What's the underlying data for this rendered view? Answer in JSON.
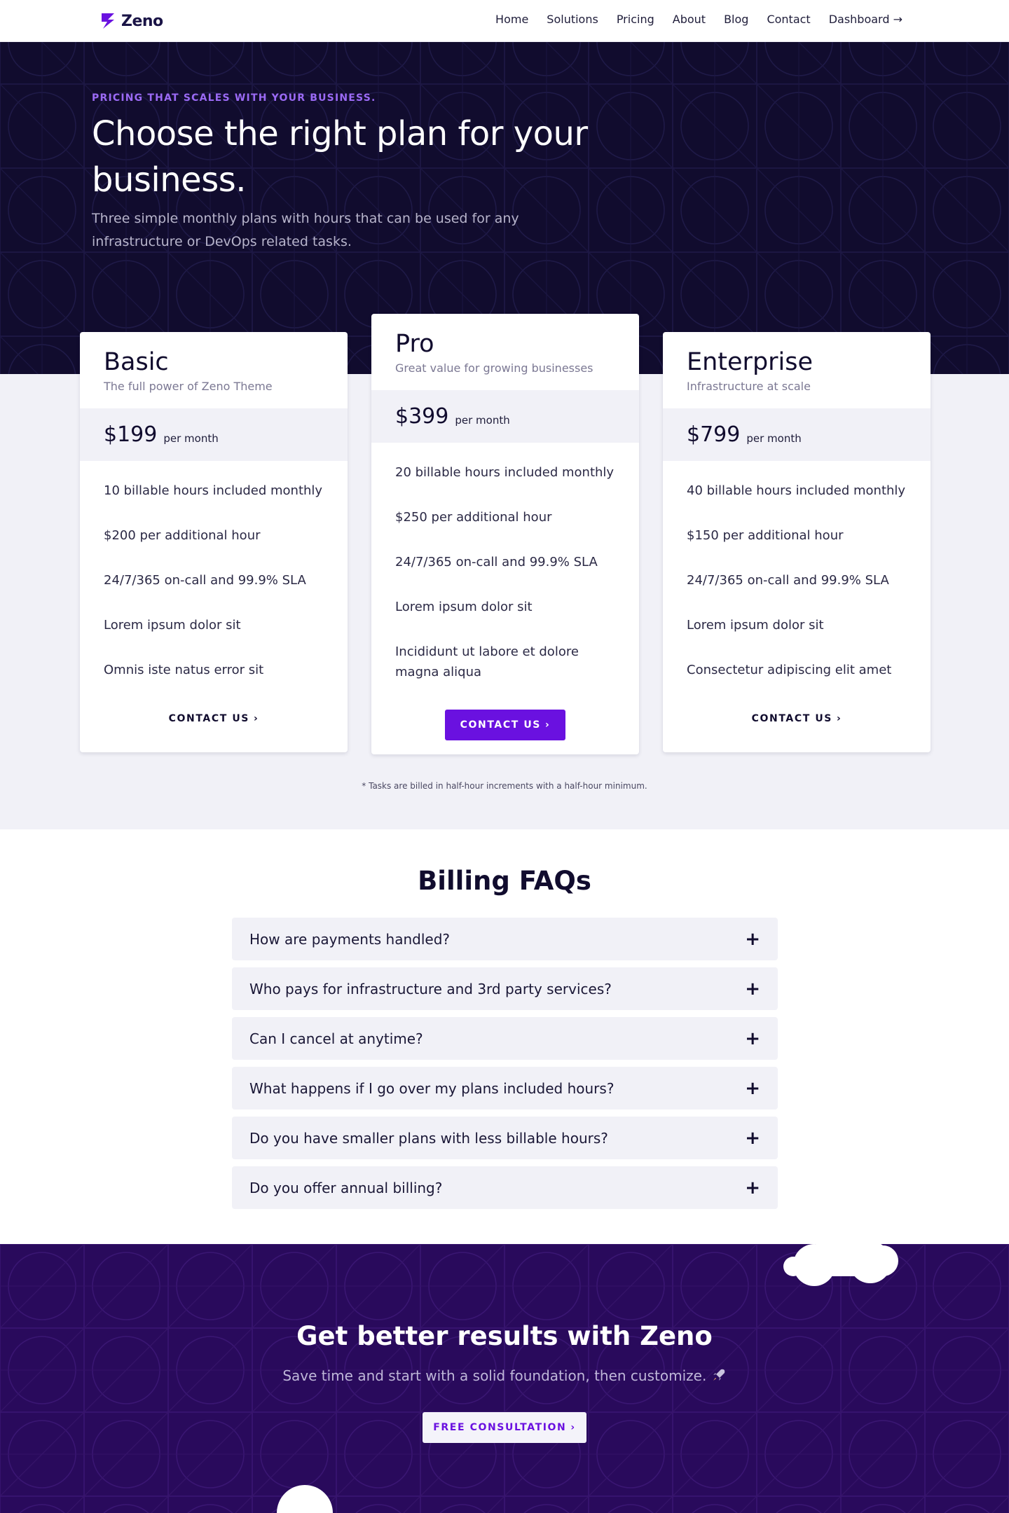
{
  "brand": {
    "name": "Zeno",
    "accent": "#6a11e0",
    "dark": "#110c2e"
  },
  "nav": {
    "links": [
      "Home",
      "Solutions",
      "Pricing",
      "About",
      "Blog",
      "Contact",
      "Dashboard"
    ],
    "dashboard_arrow": "→"
  },
  "hero": {
    "eyebrow": "PRICING THAT SCALES WITH YOUR BUSINESS.",
    "title": "Choose the right plan for your business.",
    "subtitle": "Three simple monthly plans with hours that can be used for any infrastructure or DevOps related tasks."
  },
  "plans": [
    {
      "name": "Basic",
      "description": "The full power of Zeno Theme",
      "price": "$199",
      "unit": "per month",
      "features": [
        "10 billable hours included monthly",
        "$200 per additional hour",
        "24/7/365 on-call and 99.9% SLA",
        "Lorem ipsum dolor sit",
        "Omnis iste natus error sit"
      ],
      "cta": "CONTACT US"
    },
    {
      "name": "Pro",
      "description": "Great value for growing businesses",
      "price": "$399",
      "unit": "per month",
      "features": [
        "20 billable hours included monthly",
        "$250 per additional hour",
        "24/7/365 on-call and 99.9% SLA",
        "Lorem ipsum dolor sit",
        "Incididunt ut labore et dolore magna aliqua"
      ],
      "cta": "CONTACT US"
    },
    {
      "name": "Enterprise",
      "description": "Infrastructure at scale",
      "price": "$799",
      "unit": "per month",
      "features": [
        "40 billable hours included monthly",
        "$150 per additional hour",
        "24/7/365 on-call and 99.9% SLA",
        "Lorem ipsum dolor sit",
        "Consectetur adipiscing elit amet"
      ],
      "cta": "CONTACT US"
    }
  ],
  "cta_chevron": "›",
  "footnote": "* Tasks are billed in half-hour increments with a half-hour minimum.",
  "faq": {
    "title": "Billing FAQs",
    "toggle": "+",
    "items": [
      "How are payments handled?",
      "Who pays for infrastructure and 3rd party services?",
      "Can I cancel at anytime?",
      "What happens if I go over my plans included hours?",
      "Do you have smaller plans with less billable hours?",
      "Do you offer annual billing?"
    ]
  },
  "cta_section": {
    "title": "Get better results with Zeno",
    "subtitle": "Save time and start with a solid foundation, then customize.",
    "button": "FREE CONSULTATION"
  },
  "icons": {
    "logo": "zeno-bolt-icon",
    "rocket": "rocket-icon",
    "plus": "plus-icon",
    "chevron": "chevron-right-icon",
    "arrow": "arrow-right-icon"
  }
}
